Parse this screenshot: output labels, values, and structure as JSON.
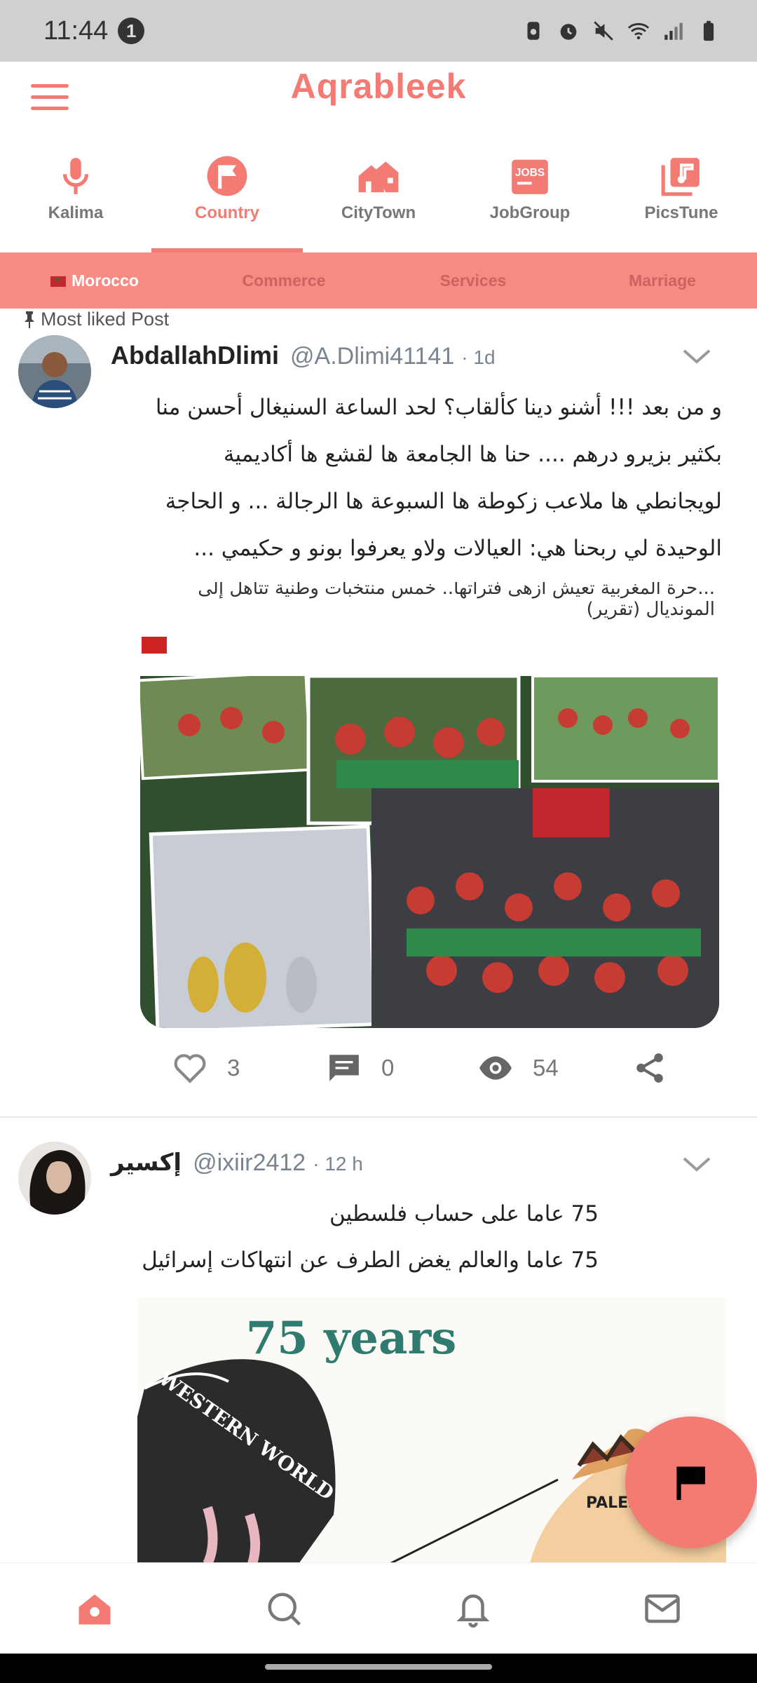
{
  "status_bar": {
    "time": "11:44",
    "notification_count": "1"
  },
  "app": {
    "logo": "Aqrableek"
  },
  "categories": [
    {
      "label": "Kalima",
      "icon": "microphone-icon"
    },
    {
      "label": "Country",
      "icon": "flag-icon",
      "active": true
    },
    {
      "label": "CityTown",
      "icon": "houses-icon"
    },
    {
      "label": "JobGroup",
      "icon": "jobs-icon",
      "badge": "JOBS"
    },
    {
      "label": "PicsTune",
      "icon": "music-pics-icon"
    }
  ],
  "subtabs": [
    {
      "label": "Morocco",
      "active": true
    },
    {
      "label": "Commerce"
    },
    {
      "label": "Services"
    },
    {
      "label": "Marriage"
    }
  ],
  "pinned_label": "Most liked Post",
  "posts": [
    {
      "author": "AbdallahDlimi",
      "handle": "@A.Dlimi41141",
      "time": "· 1d",
      "lines": [
        "و من بعد !!! أشنو دينا كألقاب؟ لحد الساعة السنيغال أحسن منا",
        "بكثير بزيرو درهم .... حنا ها الجامعة ها لقشع ها أكاديمية",
        "لويجانطي ها ملاعب زكوطة ها السبوعة ها الرجالة ... و الحاجة",
        "الوحيدة لي ربحنا هي: العيالات ولاو يعرفوا بونو و حكيمي ..."
      ],
      "image_headline_1": "...حرة المغربية تعيش أزهى فتراتها.. خمس منتخبات وطنية تتأهل إلى",
      "image_headline_2": "المونديال (تقرير)",
      "likes": "3",
      "comments": "0",
      "views": "54"
    },
    {
      "author": "إكسير",
      "handle": "@ixiir2412",
      "time": "· 12 h",
      "lines": [
        "75 عاما على حساب فلسطين",
        "75 عاما والعالم يغض الطرف عن انتهاكات إسرائيل"
      ],
      "image_title": "75 years",
      "image_caption_1": "WESTERN WORLD",
      "image_caption_2": "PALES"
    }
  ],
  "colors": {
    "accent": "#f37b74",
    "subtab_bg": "#f78b84"
  }
}
